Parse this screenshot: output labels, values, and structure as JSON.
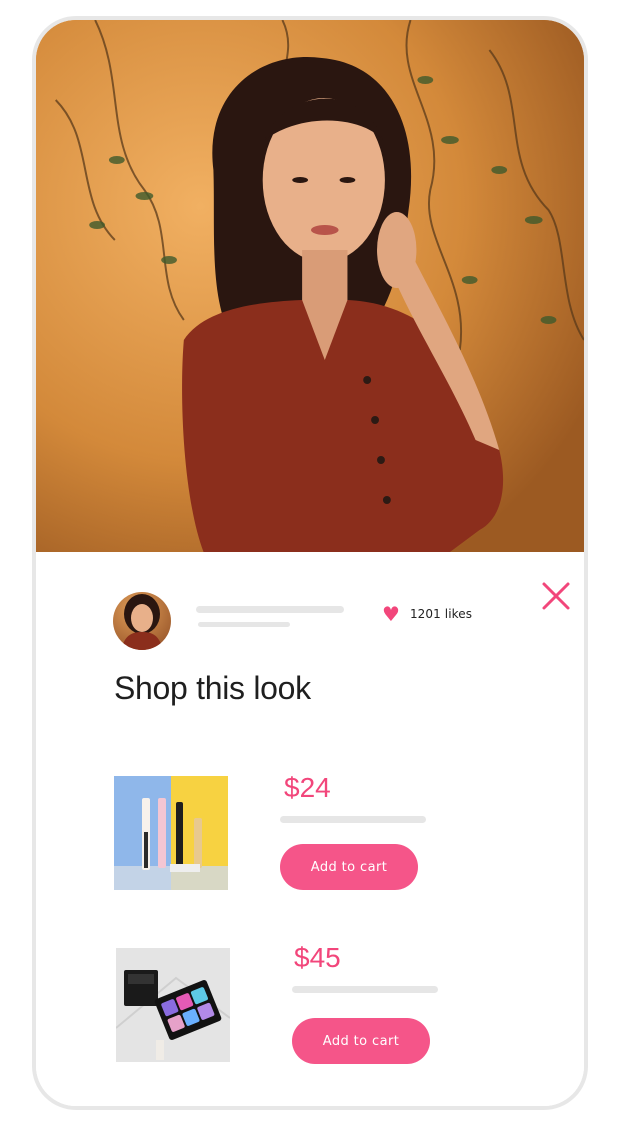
{
  "post": {
    "likes_text": "1201 likes",
    "author_avatar": "avatar-photo",
    "hero_image": "portrait-photo"
  },
  "shop": {
    "title": "Shop this look",
    "products": [
      {
        "price": "$24",
        "button_label": "Add to cart",
        "image": "lipgloss-products-photo"
      },
      {
        "price": "$45",
        "button_label": "Add to cart",
        "image": "eyeshadow-palette-photo"
      }
    ]
  },
  "icons": {
    "like": "heart-icon",
    "close": "close-icon"
  },
  "colors": {
    "accent": "#f2467b",
    "button": "#f55589",
    "placeholder": "#e6e6e6"
  }
}
